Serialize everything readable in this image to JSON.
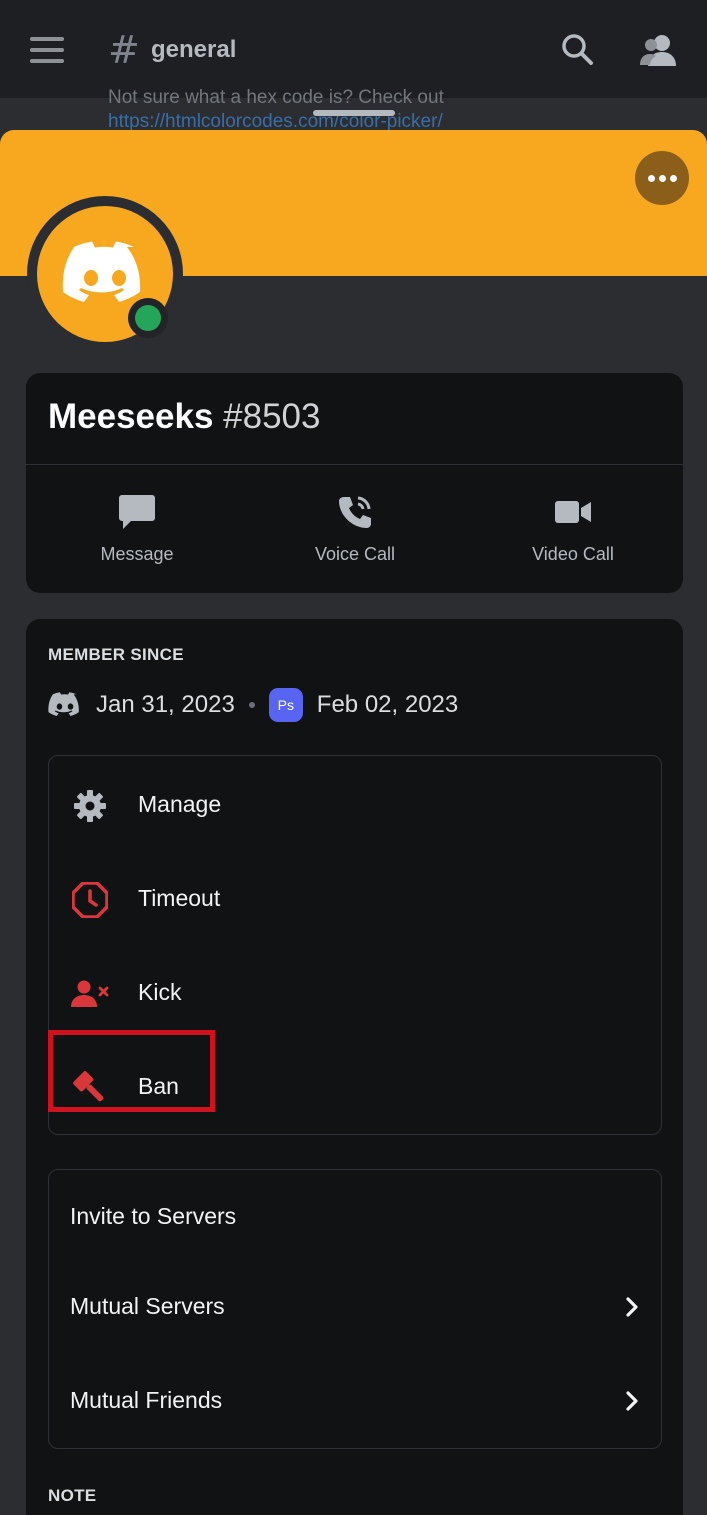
{
  "header": {
    "channel_name": "general",
    "hash_symbol": "#",
    "chat_peek_line1": "Not sure what a hex code is? Check out",
    "chat_peek_line2": "https://htmlcolorcodes.com/color-picker/"
  },
  "profile": {
    "username": "Meeseeks",
    "discriminator": "#8503",
    "status": "online",
    "banner_color": "#f8a81f",
    "status_color": "#23a55a"
  },
  "actions": [
    {
      "label": "Message",
      "icon": "chat-bubble-icon"
    },
    {
      "label": "Voice Call",
      "icon": "phone-call-icon"
    },
    {
      "label": "Video Call",
      "icon": "video-camera-icon"
    }
  ],
  "member_since": {
    "title": "MEMBER SINCE",
    "discord_date": "Jan 31, 2023",
    "server_badge": "Ps",
    "server_date": "Feb 02, 2023"
  },
  "moderation": [
    {
      "label": "Manage",
      "icon": "gear-icon"
    },
    {
      "label": "Timeout",
      "icon": "timeout-clock-icon"
    },
    {
      "label": "Kick",
      "icon": "kick-user-icon"
    },
    {
      "label": "Ban",
      "icon": "ban-hammer-icon"
    }
  ],
  "social": [
    {
      "label": "Invite to Servers",
      "has_chevron": false
    },
    {
      "label": "Mutual Servers",
      "has_chevron": true
    },
    {
      "label": "Mutual Friends",
      "has_chevron": true
    }
  ],
  "note": {
    "title": "NOTE"
  },
  "colors": {
    "danger": "#da373c",
    "highlight": "#d0121e",
    "icon_gray": "#b5bac1"
  }
}
